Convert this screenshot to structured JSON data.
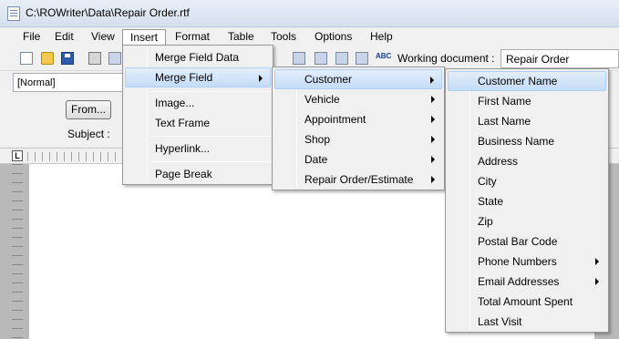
{
  "window": {
    "title": "C:\\ROWriter\\Data\\Repair Order.rtf"
  },
  "menubar": {
    "items": [
      "File",
      "Edit",
      "View",
      "Insert",
      "Format",
      "Table",
      "Tools",
      "Options",
      "Help"
    ]
  },
  "toolbar": {
    "spell_icon_text": "ABC",
    "working_document_label": "Working document :",
    "working_document_value": "Repair Order"
  },
  "format_bar": {
    "style_value": "[Normal]"
  },
  "form": {
    "from_button": "From...",
    "subject_label": "Subject :"
  },
  "ruler": {
    "corner_label": "L"
  },
  "insert_menu": {
    "items": [
      "Merge Field Data",
      "Merge Field",
      "Image...",
      "Text Frame",
      "Hyperlink...",
      "Page Break"
    ],
    "highlighted": "Merge Field"
  },
  "merge_field_menu": {
    "items": [
      "Customer",
      "Vehicle",
      "Appointment",
      "Shop",
      "Date",
      "Repair Order/Estimate"
    ],
    "highlighted": "Customer"
  },
  "customer_menu": {
    "items": [
      "Customer Name",
      "First Name",
      "Last Name",
      "Business Name",
      "Address",
      "City",
      "State",
      "Zip",
      "Postal Bar Code",
      "Phone Numbers",
      "Email Addresses",
      "Total Amount Spent",
      "Last Visit"
    ],
    "highlighted": "Customer Name"
  }
}
